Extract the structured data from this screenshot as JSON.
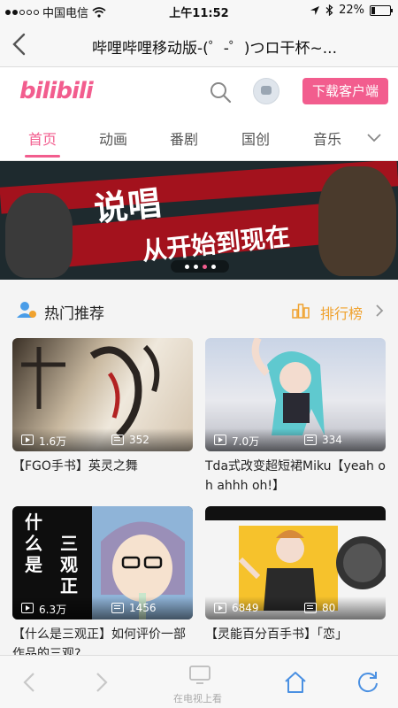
{
  "status_bar": {
    "carrier": "中国电信",
    "time": "上午11:52",
    "battery_percent": "22%",
    "battery_level": 0.22
  },
  "browser": {
    "page_title": "哔哩哔哩移动版-(゜-゜)つロ干杯~..."
  },
  "header": {
    "logo_text": "bilibili",
    "download_label": "下载客户端"
  },
  "tabs": [
    "首页",
    "动画",
    "番剧",
    "国创",
    "音乐"
  ],
  "banner": {
    "headline": "说唱",
    "subline": "从开始到现在",
    "slide_count": 4,
    "active_slide": 2
  },
  "section": {
    "title": "热门推荐",
    "rank_label": "排行榜"
  },
  "videos": [
    {
      "views": "1.6万",
      "danmaku": "352",
      "title": "【FGO手书】英灵之舞"
    },
    {
      "views": "7.0万",
      "danmaku": "334",
      "title": "Tda式改变超短裙Miku【yeah oh ahhh oh!】"
    },
    {
      "views": "6.3万",
      "danmaku": "1456",
      "title": "【什么是三观正】如何评价一部作品的三观?"
    },
    {
      "views": "6849",
      "danmaku": "80",
      "title": "【灵能百分百手书】「恋」"
    }
  ],
  "thumb_text": {
    "left_col": "什么是",
    "right_col": "三观正"
  },
  "toolbar": {
    "tv_label": "在电视上看"
  },
  "colors": {
    "accent": "#f25d8e",
    "rank": "#f0a22e",
    "ios_blue": "#4a90e2"
  }
}
